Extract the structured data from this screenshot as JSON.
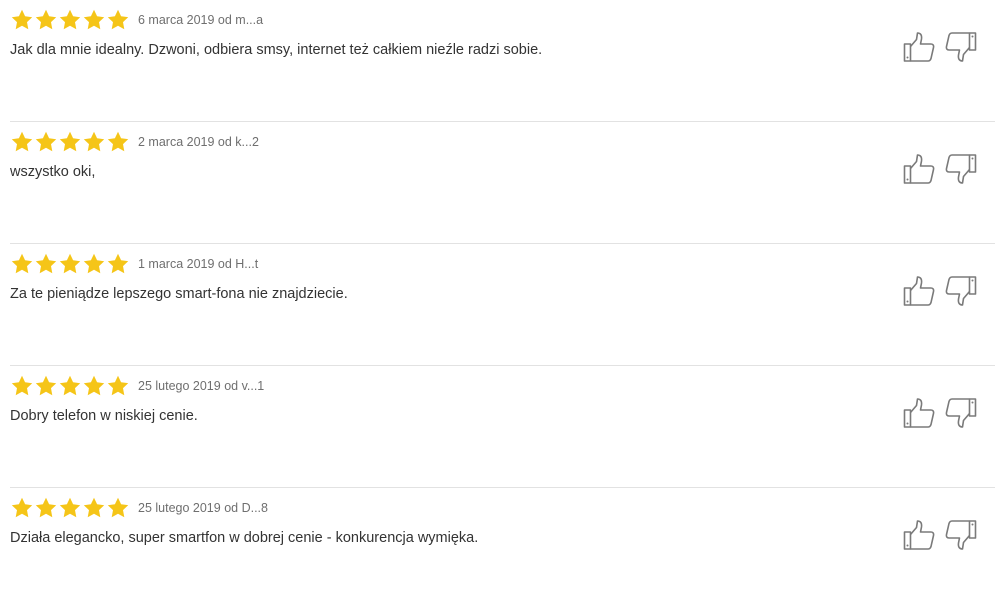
{
  "colors": {
    "star": "#f5c518",
    "icon": "#7a7a7a",
    "divider": "#e2e2e2"
  },
  "reviews": [
    {
      "rating": 5,
      "meta": "6 marca 2019 od m...a",
      "text": "Jak dla mnie idealny. Dzwoni, odbiera smsy, internet też całkiem nieźle radzi sobie."
    },
    {
      "rating": 5,
      "meta": "2 marca 2019 od k...2",
      "text": "wszystko oki,"
    },
    {
      "rating": 5,
      "meta": "1 marca 2019 od H...t",
      "text": "Za te pieniądze lepszego smart-fona nie znajdziecie."
    },
    {
      "rating": 5,
      "meta": "25 lutego 2019 od v...1",
      "text": "Dobry telefon w niskiej cenie."
    },
    {
      "rating": 5,
      "meta": "25 lutego 2019 od D...8",
      "text": "Działa elegancko, super smartfon w dobrej cenie - konkurencja wymięka."
    }
  ]
}
